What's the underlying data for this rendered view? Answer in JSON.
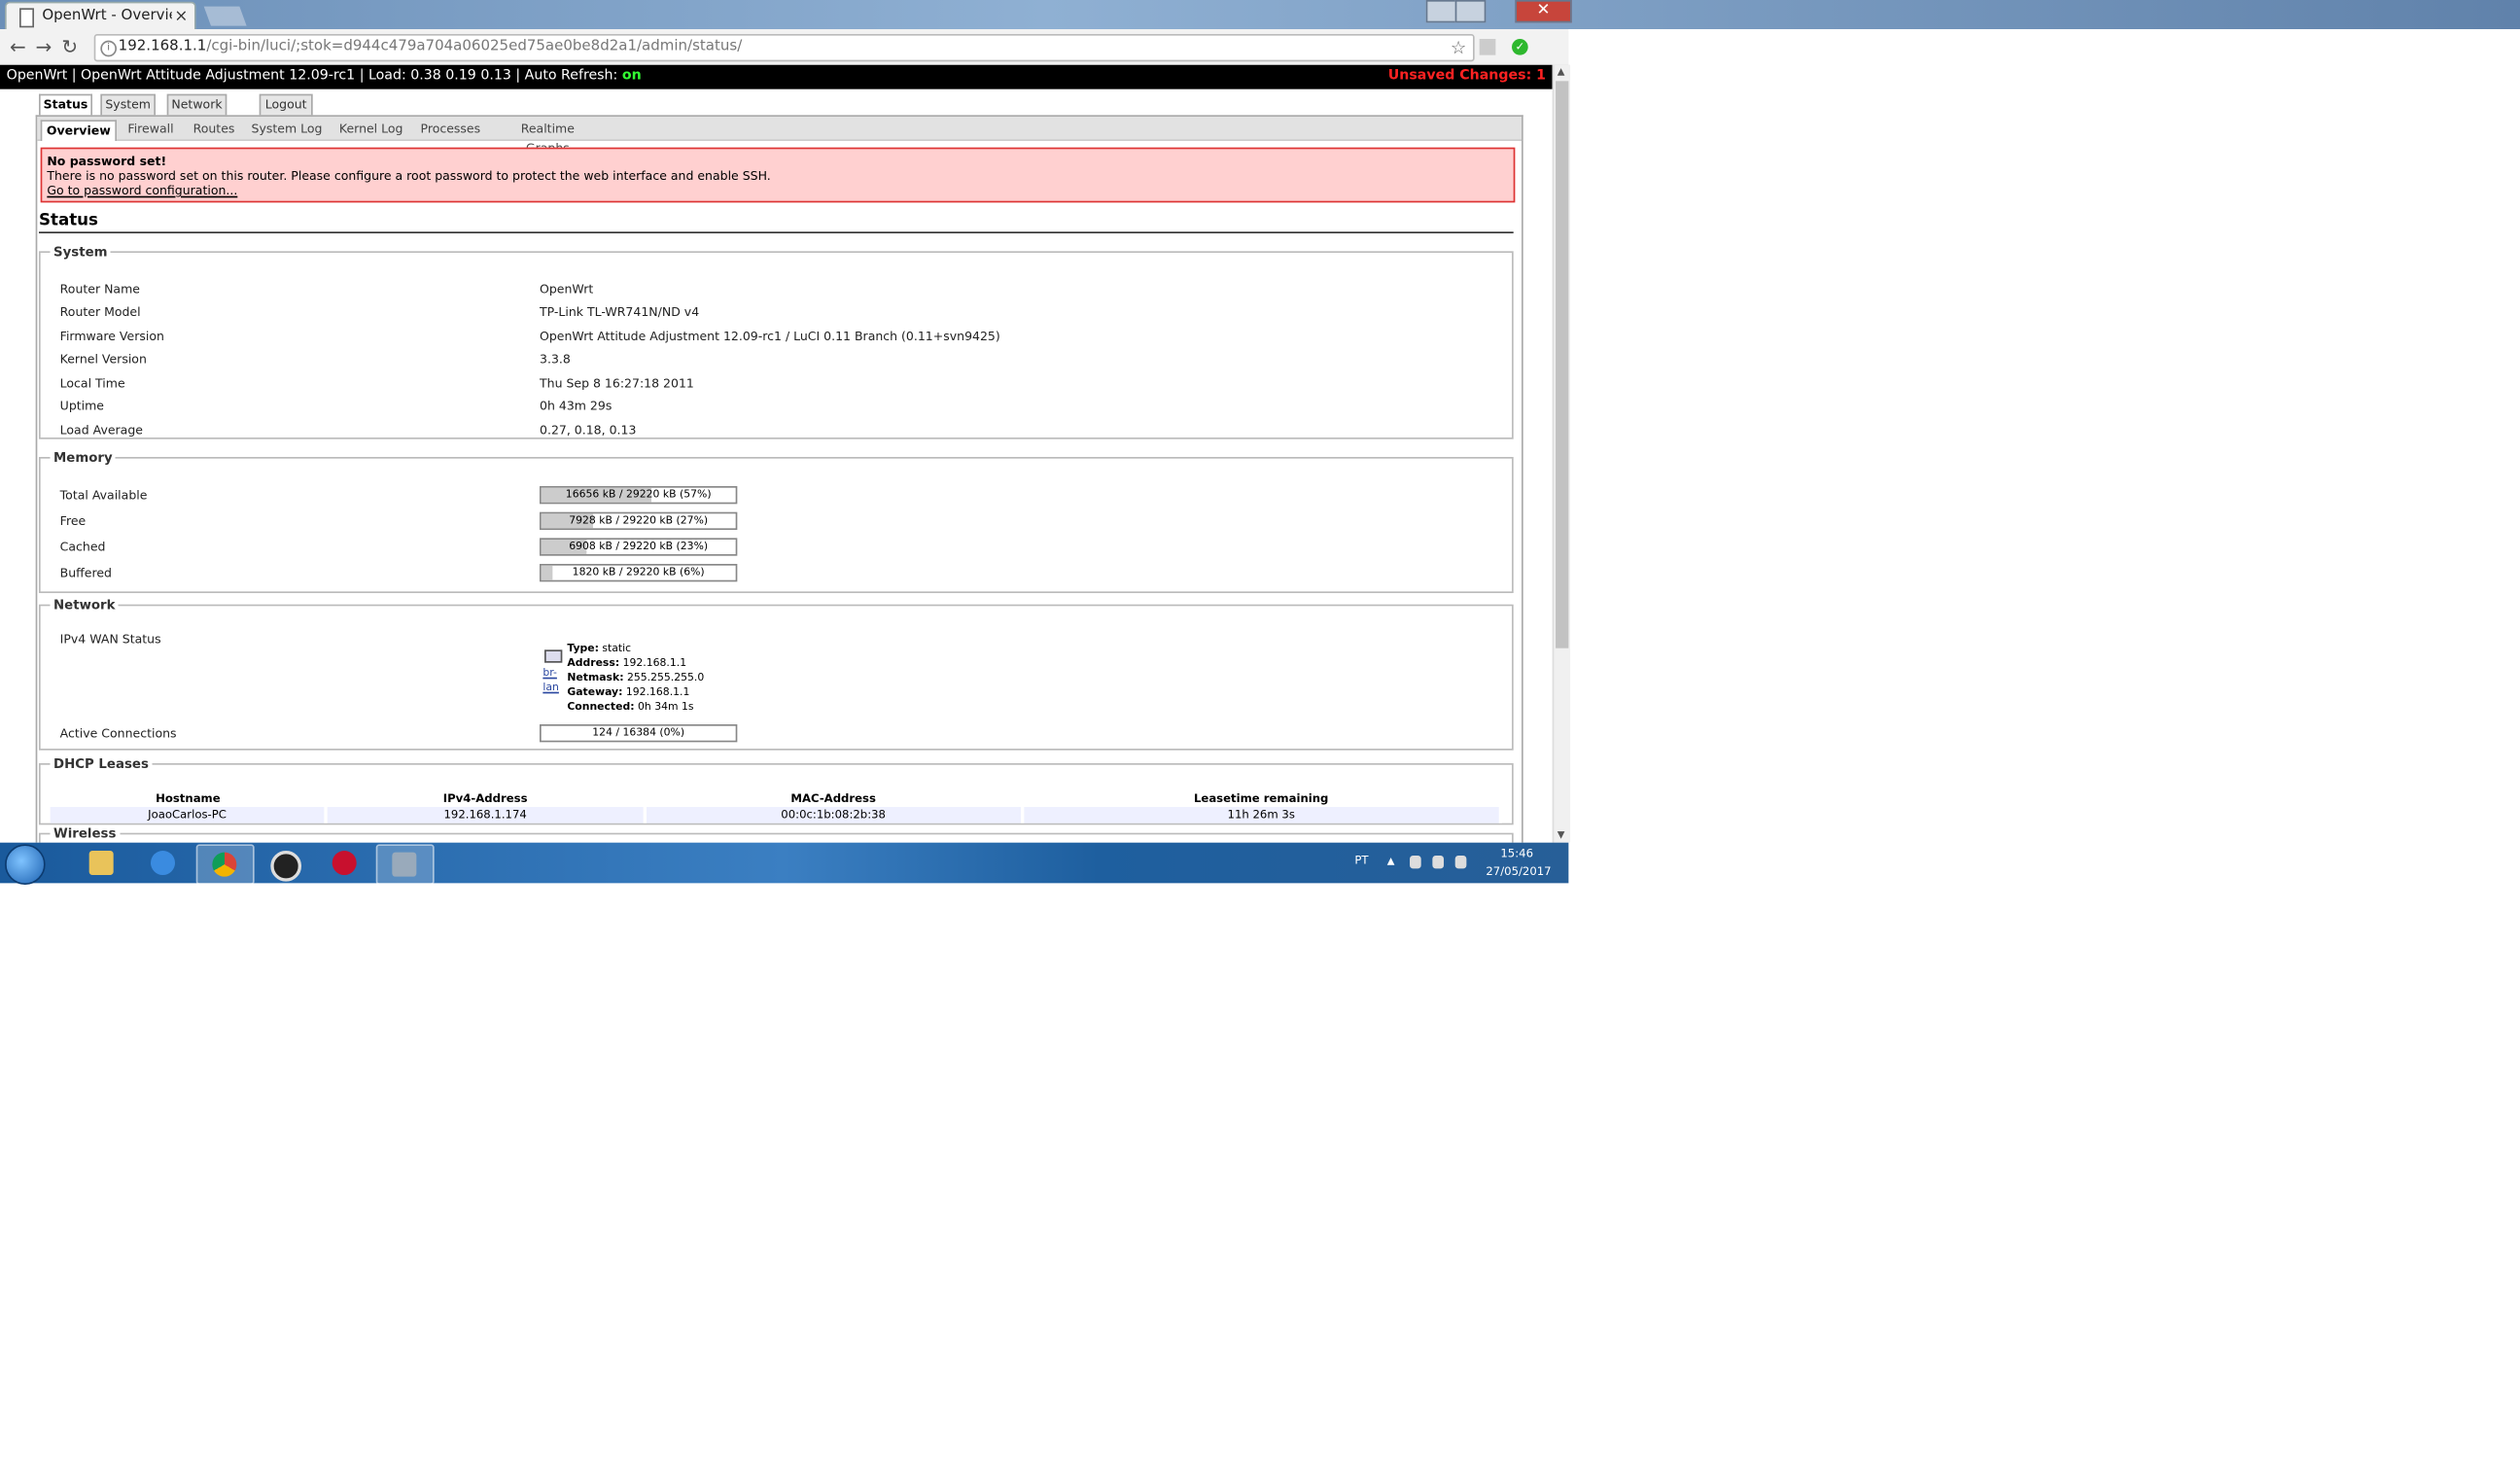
{
  "browser": {
    "tab_title": "OpenWrt - Overview - LuCI",
    "tab_close": "×",
    "url_host": "192.168.1.1",
    "url_path": "/cgi-bin/luci/;stok=d944c479a704a06025ed75ae0be8d2a1/admin/status/",
    "back": "←",
    "forward": "→",
    "reload": "↻",
    "star": "☆",
    "menu": "⋮",
    "close": "✕"
  },
  "topbar": {
    "title": "OpenWrt | OpenWrt Attitude Adjustment 12.09-rc1 | Load: 0.38 0.19 0.13 | Auto Refresh: ",
    "auto_refresh": "on",
    "unsaved": "Unsaved Changes: 1"
  },
  "main_tabs": [
    "Status",
    "System",
    "Network",
    "Logout"
  ],
  "sub_tabs": [
    "Overview",
    "Firewall",
    "Routes",
    "System Log",
    "Kernel Log",
    "Processes",
    "Realtime Graphs"
  ],
  "alert": {
    "heading": "No password set!",
    "message": "There is no password set on this router. Please configure a root password to protect the web interface and enable SSH.",
    "link": "Go to password configuration..."
  },
  "status_title": "Status",
  "system": {
    "legend": "System",
    "rows": [
      {
        "label": "Router Name",
        "value": "OpenWrt"
      },
      {
        "label": "Router Model",
        "value": "TP-Link TL-WR741N/ND v4"
      },
      {
        "label": "Firmware Version",
        "value": "OpenWrt Attitude Adjustment 12.09-rc1 / LuCI 0.11 Branch (0.11+svn9425)"
      },
      {
        "label": "Kernel Version",
        "value": "3.3.8"
      },
      {
        "label": "Local Time",
        "value": "Thu Sep 8 16:27:18 2011"
      },
      {
        "label": "Uptime",
        "value": "0h 43m 29s"
      },
      {
        "label": "Load Average",
        "value": "0.27, 0.18, 0.13"
      }
    ]
  },
  "memory": {
    "legend": "Memory",
    "rows": [
      {
        "label": "Total Available",
        "text": "16656 kB / 29220 kB (57%)",
        "fraction": 0.57
      },
      {
        "label": "Free",
        "text": "7928 kB / 29220 kB (27%)",
        "fraction": 0.27
      },
      {
        "label": "Cached",
        "text": "6908 kB / 29220 kB (23%)",
        "fraction": 0.23
      },
      {
        "label": "Buffered",
        "text": "1820 kB / 29220 kB (6%)",
        "fraction": 0.06
      }
    ]
  },
  "network": {
    "legend": "Network",
    "wan_label": "IPv4 WAN Status",
    "iface_links": [
      "br-",
      "lan"
    ],
    "wan": {
      "type_k": "Type:",
      "type_v": " static",
      "address_k": "Address:",
      "address_v": " 192.168.1.1",
      "netmask_k": "Netmask:",
      "netmask_v": " 255.255.255.0",
      "gateway_k": "Gateway:",
      "gateway_v": " 192.168.1.1",
      "connected_k": "Connected:",
      "connected_v": " 0h 34m 1s"
    },
    "conn_label": "Active Connections",
    "conn_text": "124 / 16384 (0%)",
    "conn_fraction": 0.0
  },
  "dhcp": {
    "legend": "DHCP Leases",
    "headers": [
      "Hostname",
      "IPv4-Address",
      "MAC-Address",
      "Leasetime remaining"
    ],
    "rows": [
      [
        "JoaoCarlos-PC",
        "192.168.1.174",
        "00:0c:1b:08:2b:38",
        "11h 26m 3s"
      ]
    ]
  },
  "wireless": {
    "legend": "Wireless"
  },
  "taskbar": {
    "lang": "PT",
    "time": "15:46",
    "date": "27/05/2017",
    "apps": [
      "explorer-icon",
      "internet-explorer-icon",
      "chrome-icon",
      "ccleaner-icon",
      "avira-icon",
      "network-tool-icon"
    ]
  }
}
